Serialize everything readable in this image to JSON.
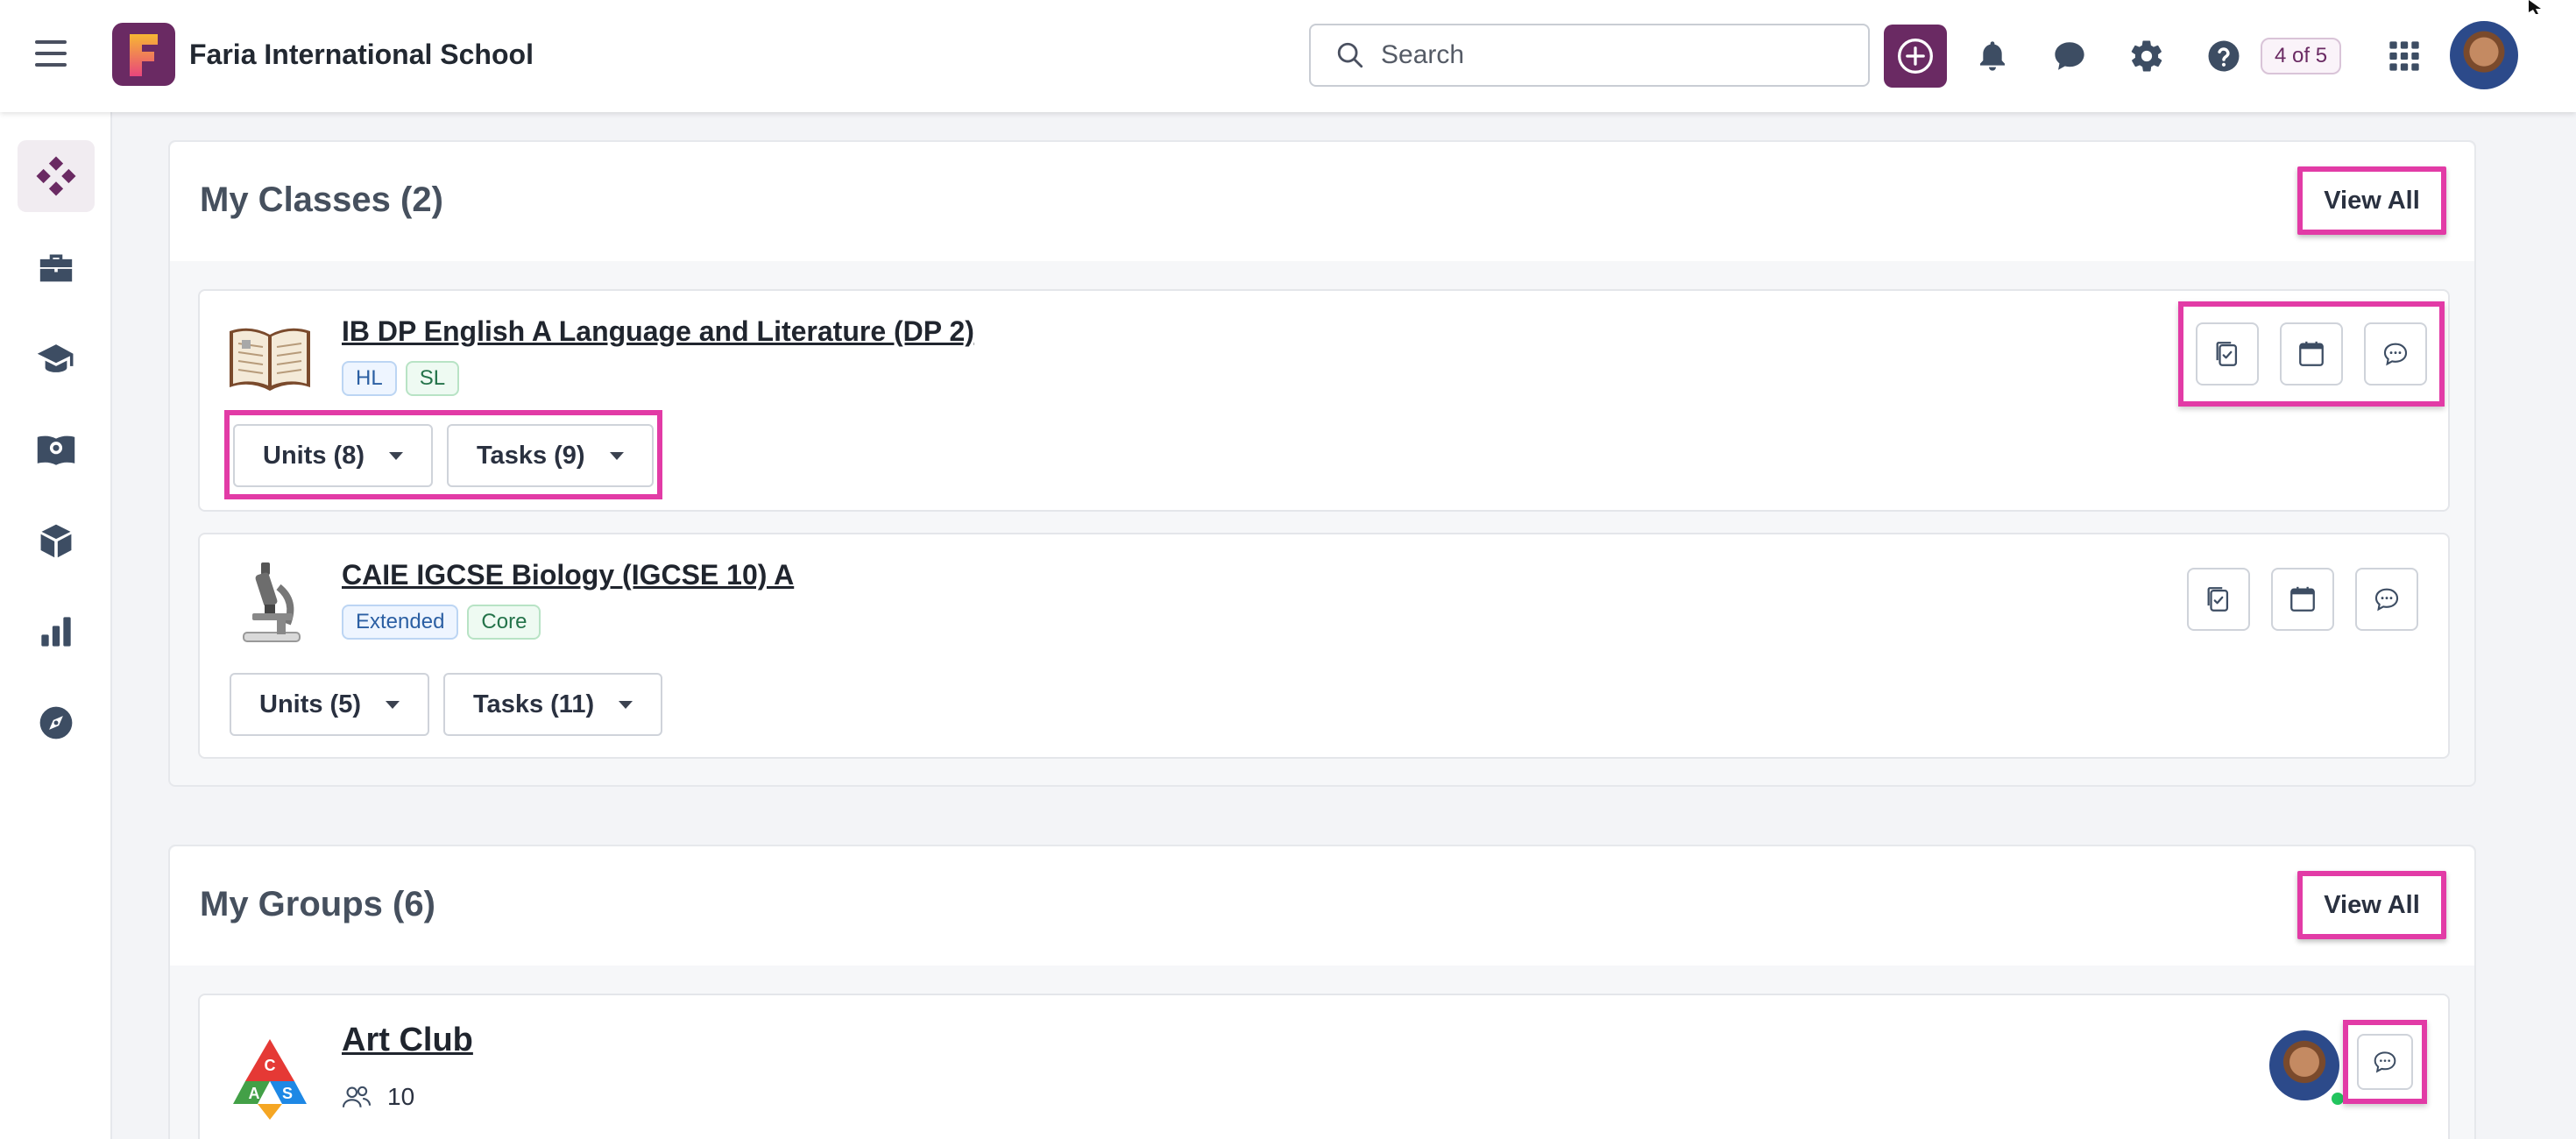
{
  "header": {
    "school_name": "Faria International School",
    "logo_letter": "F",
    "search_placeholder": "Search",
    "count_badge": "4 of 5"
  },
  "icons": {
    "menu": "hamburger-icon",
    "search": "search-icon",
    "add": "plus-circle-icon",
    "notifications": "bell-icon",
    "messages": "chat-bubble-icon",
    "settings": "gear-icon",
    "help": "question-icon",
    "apps": "grid-icon"
  },
  "sidebar": {
    "items": [
      {
        "icon": "dashboard-icon",
        "active": true
      },
      {
        "icon": "briefcase-icon"
      },
      {
        "icon": "graduation-cap-icon"
      },
      {
        "icon": "curriculum-book-icon"
      },
      {
        "icon": "cube-icon"
      },
      {
        "icon": "bar-chart-icon"
      },
      {
        "icon": "compass-icon"
      }
    ]
  },
  "classes": {
    "title": "My Classes (2)",
    "view_all": "View All",
    "items": [
      {
        "name": "IB DP English A Language and Literature (DP 2)",
        "tags": [
          "HL",
          "SL"
        ],
        "units": "Units (8)",
        "tasks": "Tasks (9)"
      },
      {
        "name": "CAIE IGCSE Biology (IGCSE 10) A",
        "tags": [
          "Extended",
          "Core"
        ],
        "units": "Units (5)",
        "tasks": "Tasks (11)"
      }
    ]
  },
  "groups": {
    "title": "My Groups (6)",
    "view_all": "View All",
    "items": [
      {
        "name": "Art Club",
        "members": "10",
        "logo_letters": [
          "C",
          "A",
          "S"
        ]
      }
    ]
  },
  "colors": {
    "brand": "#6a2a63",
    "highlight": "#e23ba6",
    "sidebar_icon": "#3d4d63",
    "online": "#22c55e"
  }
}
